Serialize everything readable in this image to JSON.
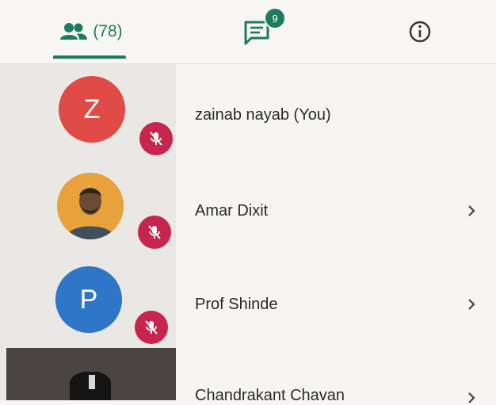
{
  "tabs": {
    "participants_count": "(78)",
    "chat_unread": "9",
    "active": "participants"
  },
  "participants": [
    {
      "name": "zainab nayab (You)",
      "initial": "Z",
      "avatar_color": "#e04b48",
      "muted": true,
      "has_chevron": false
    },
    {
      "name": "Amar Dixit",
      "initial": "",
      "avatar_color": "#e9a23b",
      "muted": true,
      "has_chevron": true
    },
    {
      "name": "Prof Shinde",
      "initial": "P",
      "avatar_color": "#2f75c8",
      "muted": true,
      "has_chevron": true
    },
    {
      "name": "Chandrakant Chavan",
      "initial": "",
      "avatar_color": "#4a4543",
      "muted": false,
      "has_chevron": true
    }
  ],
  "colors": {
    "accent": "#1f7b5f",
    "mute": "#c7254e"
  }
}
